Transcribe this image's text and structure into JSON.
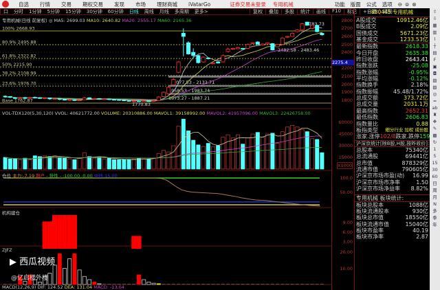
{
  "menu": {
    "items": [
      "自选",
      "行情",
      "交易",
      "期权交易",
      "发现",
      "市场",
      "理财商城",
      "iVatarGo"
    ],
    "login_status": "证券交易未登录",
    "board": "专用机械",
    "right": [
      "功能",
      "版面",
      "公式",
      "选项"
    ]
  },
  "periods": {
    "items": [
      "口",
      "分时",
      "1分钟",
      "5分钟",
      "15分钟",
      "30分钟",
      "60分钟",
      "日线",
      "周线",
      "月线",
      "多周期",
      "更多>"
    ],
    "active": "日线"
  },
  "tools": [
    "复权",
    "叠加",
    "多股",
    "统计",
    "画线",
    "F10",
    "标记",
    "+自选",
    "返回"
  ],
  "legend": {
    "title": "专用机械(日线 前复权) ◎",
    "ma5": "MA5: 2699.03",
    "ma10": "MA10: 2640.82",
    "ma20": "MA20: 2555.17",
    "ma60": "MA60: 2165.36"
  },
  "fib": [
    {
      "label": "100% 2668.93",
      "p": 2668.93
    },
    {
      "label": "80.9% 2495.88",
      "p": 2495.88
    },
    {
      "label": "61.8% 2322.82",
      "p": 2322.82
    },
    {
      "label": "50% 2215.90",
      "p": 2215.9
    },
    {
      "label": "38.2% 2108.99",
      "p": 2108.99
    },
    {
      "label": "23.6% 1976.70",
      "p": 1976.7
    },
    {
      "label": "Base 1762.87",
      "p": 1762.87
    }
  ],
  "annotations": {
    "high": "2783.73",
    "low": "1770.83",
    "r1": "2482.58 - 2483.46",
    "r2": "2077.53 - 2132.71",
    "r3": "1958.53 - 1983.74",
    "r4": "1873.27 - 1887.21"
  },
  "price_axis": {
    "labels": [
      "2800",
      "2700",
      "2600",
      "2500",
      "2400",
      "2200",
      "2100",
      "2000",
      "1900",
      "1800"
    ],
    "current": "2275.4"
  },
  "candles": [
    [
      1850,
      1840,
      1860,
      1830
    ],
    [
      1845,
      1835,
      1850,
      1825
    ],
    [
      1830,
      1825,
      1840,
      1815
    ],
    [
      1825,
      1830,
      1840,
      1815
    ],
    [
      1832,
      1822,
      1840,
      1815
    ],
    [
      1825,
      1832,
      1840,
      1815
    ],
    [
      1835,
      1830,
      1845,
      1820
    ],
    [
      1830,
      1822,
      1838,
      1815
    ],
    [
      1822,
      1828,
      1835,
      1815
    ],
    [
      1828,
      1815,
      1832,
      1805
    ],
    [
      1815,
      1818,
      1830,
      1810
    ],
    [
      1818,
      1810,
      1825,
      1800
    ],
    [
      1810,
      1800,
      1815,
      1795
    ],
    [
      1800,
      1805,
      1812,
      1795
    ],
    [
      1805,
      1795,
      1810,
      1790
    ],
    [
      1795,
      1800,
      1810,
      1790
    ],
    [
      1805,
      1830,
      1840,
      1800
    ],
    [
      1830,
      1815,
      1835,
      1810
    ],
    [
      1815,
      1820,
      1828,
      1810
    ],
    [
      1820,
      1812,
      1825,
      1805
    ],
    [
      1812,
      1815,
      1822,
      1808
    ],
    [
      1815,
      1808,
      1820,
      1800
    ],
    [
      1808,
      1805,
      1815,
      1798
    ],
    [
      1805,
      1800,
      1812,
      1795
    ],
    [
      1800,
      1795,
      1808,
      1790
    ],
    [
      1795,
      1785,
      1800,
      1780
    ],
    [
      1785,
      1790,
      1798,
      1770
    ],
    [
      1790,
      1786,
      1796,
      1782
    ],
    [
      1786,
      1790,
      1798,
      1782
    ],
    [
      1790,
      1785,
      1795,
      1780
    ],
    [
      1785,
      1792,
      1800,
      1780
    ],
    [
      1795,
      1840,
      1850,
      1790
    ],
    [
      1845,
      1900,
      1910,
      1840
    ],
    [
      1880,
      1960,
      1975,
      1870
    ],
    [
      1990,
      2060,
      2075,
      1985
    ],
    [
      2150,
      2280,
      2290,
      2140
    ],
    [
      2640,
      2600,
      2700,
      2350
    ],
    [
      2520,
      2380,
      2540,
      2370
    ],
    [
      2400,
      2360,
      2450,
      2340
    ],
    [
      2360,
      2270,
      2370,
      2260
    ],
    [
      2280,
      2340,
      2350,
      2270
    ],
    [
      2330,
      2320,
      2335,
      2310
    ],
    [
      2262,
      2265,
      2275,
      2255
    ],
    [
      2280,
      2265,
      2285,
      2260
    ],
    [
      2280,
      2360,
      2375,
      2275
    ],
    [
      2410,
      2440,
      2460,
      2400
    ],
    [
      2440,
      2450,
      2458,
      2430
    ],
    [
      2445,
      2460,
      2470,
      2440
    ],
    [
      2450,
      2445,
      2455,
      2440
    ],
    [
      2450,
      2500,
      2510,
      2445
    ],
    [
      2515,
      2520,
      2525,
      2505
    ],
    [
      2530,
      2500,
      2540,
      2495
    ],
    [
      2490,
      2505,
      2512,
      2485
    ],
    [
      2505,
      2520,
      2525,
      2500
    ],
    [
      2510,
      2430,
      2515,
      2425
    ],
    [
      2470,
      2500,
      2505,
      2465
    ],
    [
      2500,
      2580,
      2590,
      2495
    ],
    [
      2590,
      2600,
      2608,
      2580
    ],
    [
      2600,
      2640,
      2650,
      2595
    ],
    [
      2660,
      2680,
      2690,
      2650
    ],
    [
      2680,
      2760,
      2770,
      2675
    ],
    [
      2780,
      2740,
      2784,
      2735
    ],
    [
      2700,
      2740,
      2750,
      2690
    ],
    [
      2740,
      2660,
      2745,
      2650
    ],
    [
      2640,
      2620,
      2650,
      2610
    ]
  ],
  "volume": {
    "legend": {
      "name": "VOL-TDX120(5,30,120)",
      "vvol": "VVOL: 40621772.00",
      "volume": "VOLUME: 20310886.00",
      "mavol1": "MAVOL1: 39158992.00",
      "mavol2": "MAVOL2: 41957096.00",
      "mavol3": "MAVOL3: 22426758.00"
    },
    "axis": [
      "60000",
      "45000",
      "30000",
      "15000"
    ],
    "unit": "X1000",
    "values": [
      15000,
      13000,
      13000,
      12000,
      14000,
      12000,
      17000,
      16000,
      17000,
      16000,
      17000,
      15000,
      14000,
      13000,
      12000,
      14000,
      21000,
      16000,
      14000,
      15000,
      13000,
      14000,
      12000,
      12000,
      12000,
      12000,
      13000,
      14000,
      13000,
      13000,
      14000,
      20000,
      24000,
      22000,
      30000,
      55000,
      64000,
      49000,
      37000,
      31000,
      29000,
      33000,
      29000,
      30000,
      41000,
      44000,
      40000,
      44000,
      32000,
      40000,
      45000,
      47000,
      41000,
      45000,
      46000,
      33000,
      48000,
      54000,
      56000,
      54000,
      51000,
      48000,
      39000,
      38000,
      21000
    ]
  },
  "position": {
    "legend": {
      "name": "仓位",
      "main": "主力:-7.19",
      "retail": "散户",
      "hot": "- 获性 - :100.00 :0.00",
      "mid": "中线:15.00"
    },
    "axis": [
      "100.0",
      "50.00"
    ],
    "values": [
      100,
      100,
      100,
      100,
      100,
      100,
      100,
      100,
      100,
      100,
      100,
      100,
      100,
      100,
      100,
      100,
      100,
      100,
      100,
      100,
      100,
      100,
      100,
      100,
      100,
      100,
      100,
      100,
      100,
      100,
      100,
      100,
      98,
      92,
      80,
      68,
      58,
      53,
      50,
      49,
      48,
      47,
      46,
      45,
      43,
      40,
      37,
      34,
      30,
      27,
      24,
      22,
      21,
      20,
      18,
      16,
      14,
      12,
      10,
      8,
      6,
      4,
      2,
      1,
      0
    ]
  },
  "inst": {
    "legend": "机构建仓",
    "axis": [
      "9.00",
      "6.00",
      "3.00"
    ],
    "bars": {
      "8": 8.5,
      "9": 8.5,
      "10": 10.5,
      "11": 10.5,
      "12": 10.5,
      "13": 10.5,
      "14": 10.5,
      "26": 4,
      "27": 4
    }
  },
  "zjfz": {
    "legend": "ZJFZ",
    "axis": [
      "20.00",
      "10.00"
    ],
    "bars": [
      [
        3,
        5,
        "r"
      ],
      [
        4,
        2,
        "w"
      ],
      [
        5,
        6,
        "r"
      ],
      [
        6,
        3,
        "w"
      ],
      [
        7,
        1.5,
        "w"
      ],
      [
        8,
        5,
        "w"
      ],
      [
        9,
        7,
        "w"
      ],
      [
        10,
        12,
        "w"
      ],
      [
        11,
        19,
        "r"
      ],
      [
        12,
        10,
        "w"
      ],
      [
        13,
        16,
        "w"
      ],
      [
        14,
        19,
        "r"
      ],
      [
        15,
        9,
        "w"
      ],
      [
        16,
        5,
        "w"
      ],
      [
        17,
        3,
        "w"
      ],
      [
        18,
        1.5,
        "r"
      ],
      [
        19,
        0.5,
        "w"
      ],
      [
        27,
        6,
        "r"
      ],
      [
        28,
        3,
        "w"
      ],
      [
        29,
        1.5,
        "w"
      ],
      [
        30,
        0.8,
        "w"
      ],
      [
        31,
        0.5,
        "y"
      ]
    ]
  },
  "macd": {
    "name": "MACD(12,26,9)",
    "dif": "DIF: 124.52",
    "dea": "DEA: 131.04",
    "macd": "MACD: -13.04"
  },
  "watermark": {
    "brand": "西瓜视频",
    "author": "@亿启楼外楼"
  },
  "panel": {
    "code": "880445 专用机械",
    "rows1": [
      [
        "A股成交",
        "10912.46亿",
        "#ee3"
      ],
      [
        "B股成交",
        "2.09亿",
        "#ee3"
      ],
      [
        "国债成交",
        "5671.23亿",
        "#ee3"
      ],
      [
        "基金成交",
        "1233.53亿",
        "#ee3"
      ]
    ],
    "rows2": [
      [
        "最新指数",
        "2618.33",
        "#3e3"
      ],
      [
        "今日开盘",
        "2635.38",
        "#3e3"
      ],
      [
        "昨日收盘",
        "2643.41",
        "#fff"
      ],
      [
        "指数涨跌",
        "-25.08",
        "#3e3"
      ],
      [
        "指数涨幅",
        "-0.95%",
        "#3e3"
      ],
      [
        "平均涨幅",
        "-0.12%",
        "#3e3"
      ],
      [
        "指数换手",
        "2.18%",
        "#ddd"
      ],
      [
        "指数振幅",
        "45.48/1.72%",
        "#ddd"
      ],
      [
        "总成交额",
        "373.72亿",
        "#ee3"
      ],
      [
        "总成交量",
        "2031.1万",
        "#ee3"
      ],
      [
        "最高指数",
        "2652.31",
        "#e33"
      ],
      [
        "最低指数",
        "2606.83",
        "#3e3"
      ],
      [
        "指数量比",
        "0.88",
        "#ee3"
      ]
    ],
    "type_label": "板指类型",
    "type_value": "细分行业 加权 成份股",
    "updown": {
      "up_label": "涨家.涨停",
      "up_value": "102/8",
      "down_label": "跌家.跌停",
      "down_value": "159/0"
    },
    "stats_title": "沪深京统计[除B股,H股,按昨收价]:",
    "rows3": [
      [
        "总股本",
        "75340亿"
      ],
      [
        "总流通股",
        "69441亿"
      ],
      [
        "总市值",
        "878329亿"
      ],
      [
        "流通市值",
        "790605亿"
      ],
      [
        "沪深京市场市盈(动)",
        "16.99"
      ],
      [
        "沪深京市场市净率",
        "1.50"
      ],
      [
        "沪深京市场净益率",
        "8.82%"
      ]
    ],
    "block_title": "专用机械 板块统计:",
    "rows4": [
      [
        "板块总股本",
        "1088亿"
      ],
      [
        "板块流通股本",
        "930亿"
      ],
      [
        "板块总市值",
        "18550亿"
      ],
      [
        "板块流通市值",
        "15040亿"
      ],
      [
        "板块市盈率",
        "40.19"
      ],
      [
        "板块市净率",
        "2.87"
      ]
    ]
  },
  "sidebar": {
    "icons": [
      "up-arrow",
      "down-arrow",
      "grid",
      "bars",
      "line-chart",
      "candle",
      "doc",
      "f10",
      "note",
      "fin",
      "report",
      "calc",
      "circle",
      "wave",
      "ab",
      "bag",
      "move",
      "pencil",
      "ts",
      "refresh"
    ],
    "periods": [
      "1",
      "5",
      "15",
      "30",
      "60",
      "日",
      "周",
      "月",
      "N",
      "多",
      "季",
      "年"
    ]
  },
  "colors": {
    "up": "#ff3232",
    "down": "#54ffff",
    "ma5": "#cccccc",
    "ma10": "#dddd55",
    "ma20": "#cc44cc",
    "ma60": "#33aa33",
    "fib": "#9a9a3a"
  }
}
